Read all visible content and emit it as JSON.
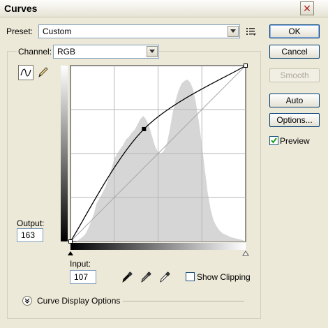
{
  "window": {
    "title": "Curves"
  },
  "preset": {
    "label": "Preset:",
    "value": "Custom"
  },
  "channel": {
    "label": "Channel:",
    "value": "RGB"
  },
  "buttons": {
    "ok": "OK",
    "cancel": "Cancel",
    "smooth": "Smooth",
    "auto": "Auto",
    "options": "Options..."
  },
  "preview": {
    "label": "Preview",
    "checked": true
  },
  "output": {
    "label": "Output:",
    "value": "163"
  },
  "input": {
    "label": "Input:",
    "value": "107"
  },
  "show_clipping": {
    "label": "Show Clipping",
    "checked": false
  },
  "display_options": {
    "label": "Curve Display Options"
  },
  "curve": {
    "points": [
      [
        0,
        0
      ],
      [
        107,
        163
      ],
      [
        255,
        255
      ]
    ],
    "selected_point": {
      "input": 107,
      "output": 163
    },
    "curve_color": "#000000",
    "histogram_color": "#d6d6d6"
  },
  "icons": {
    "close": "close-icon",
    "preset_menu": "list-menu-icon",
    "curve_tool": "curve-tool-icon",
    "pencil_tool": "pencil-icon",
    "eyedroppers": [
      "black-eyedropper-icon",
      "gray-eyedropper-icon",
      "white-eyedropper-icon"
    ],
    "expand": "chevron-double-down-icon"
  }
}
